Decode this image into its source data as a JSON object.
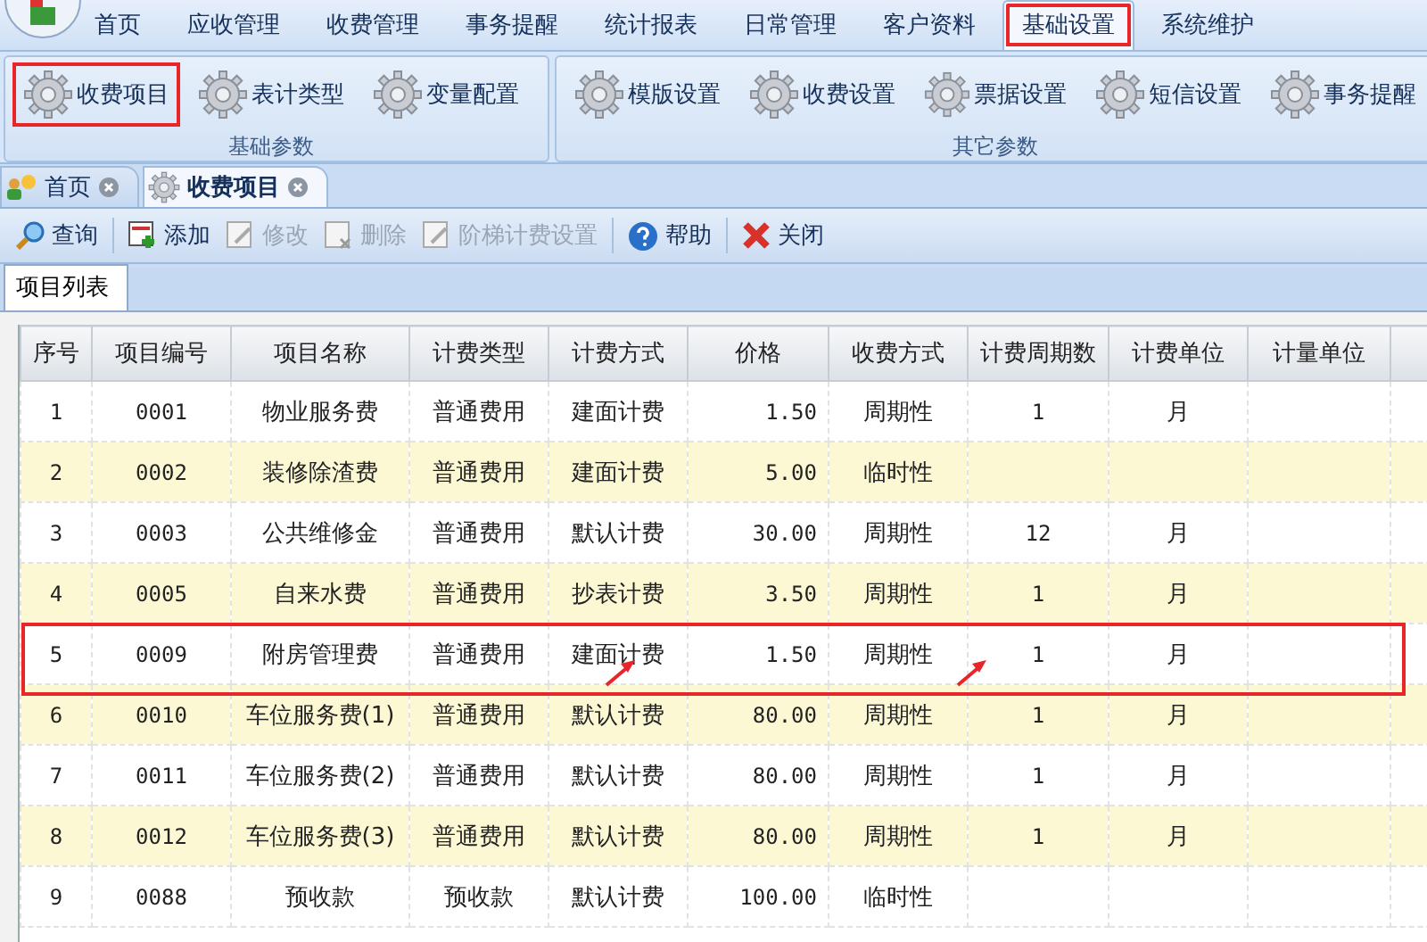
{
  "menu": {
    "items": [
      {
        "label": "首页",
        "selected": false,
        "highlighted": false
      },
      {
        "label": "应收管理",
        "selected": false,
        "highlighted": false
      },
      {
        "label": "收费管理",
        "selected": false,
        "highlighted": false
      },
      {
        "label": "事务提醒",
        "selected": false,
        "highlighted": false
      },
      {
        "label": "统计报表",
        "selected": false,
        "highlighted": false
      },
      {
        "label": "日常管理",
        "selected": false,
        "highlighted": false
      },
      {
        "label": "客户资料",
        "selected": false,
        "highlighted": false
      },
      {
        "label": "基础设置",
        "selected": true,
        "highlighted": true
      },
      {
        "label": "系统维护",
        "selected": false,
        "highlighted": false
      }
    ]
  },
  "ribbon": {
    "groups": [
      {
        "label": "基础参数",
        "buttons": [
          {
            "label": "收费项目",
            "highlighted": true
          },
          {
            "label": "表计类型",
            "highlighted": false
          },
          {
            "label": "变量配置",
            "highlighted": false
          }
        ]
      },
      {
        "label": "其它参数",
        "buttons": [
          {
            "label": "模版设置",
            "highlighted": false
          },
          {
            "label": "收费设置",
            "highlighted": false
          },
          {
            "label": "票据设置",
            "highlighted": false
          },
          {
            "label": "短信设置",
            "highlighted": false
          },
          {
            "label": "事务提醒",
            "highlighted": false
          }
        ]
      }
    ]
  },
  "doc_tabs": [
    {
      "label": "首页",
      "kind": "home",
      "selected": false
    },
    {
      "label": "收费项目",
      "kind": "gear",
      "selected": true
    }
  ],
  "toolbar": [
    {
      "label": "查询",
      "kind": "search",
      "disabled": false
    },
    {
      "label": "添加",
      "kind": "add",
      "disabled": false
    },
    {
      "label": "修改",
      "kind": "edit",
      "disabled": true
    },
    {
      "label": "删除",
      "kind": "delete",
      "disabled": true
    },
    {
      "label": "阶梯计费设置",
      "kind": "edit",
      "disabled": true
    },
    {
      "label": "帮助",
      "kind": "help",
      "disabled": false
    },
    {
      "label": "关闭",
      "kind": "close",
      "disabled": false
    }
  ],
  "sub_tabs": [
    {
      "label": "项目列表",
      "selected": true
    }
  ],
  "table": {
    "columns": [
      "序号",
      "项目编号",
      "项目名称",
      "计费类型",
      "计费方式",
      "价格",
      "收费方式",
      "计费周期数",
      "计费单位",
      "计量单位"
    ],
    "rows": [
      {
        "cells": [
          "1",
          "0001",
          "物业服务费",
          "普通费用",
          "建面计费",
          "1.50",
          "周期性",
          "1",
          "月",
          ""
        ],
        "highlighted": false
      },
      {
        "cells": [
          "2",
          "0002",
          "装修除渣费",
          "普通费用",
          "建面计费",
          "5.00",
          "临时性",
          "",
          "",
          ""
        ],
        "highlighted": false
      },
      {
        "cells": [
          "3",
          "0003",
          "公共维修金",
          "普通费用",
          "默认计费",
          "30.00",
          "周期性",
          "12",
          "月",
          ""
        ],
        "highlighted": false
      },
      {
        "cells": [
          "4",
          "0005",
          "自来水费",
          "普通费用",
          "抄表计费",
          "3.50",
          "周期性",
          "1",
          "月",
          ""
        ],
        "highlighted": false
      },
      {
        "cells": [
          "5",
          "0009",
          "附房管理费",
          "普通费用",
          "建面计费",
          "1.50",
          "周期性",
          "1",
          "月",
          ""
        ],
        "highlighted": true,
        "arrows": [
          false,
          false,
          false,
          false,
          true,
          false,
          true,
          false,
          false,
          false
        ]
      },
      {
        "cells": [
          "6",
          "0010",
          "车位服务费(1)",
          "普通费用",
          "默认计费",
          "80.00",
          "周期性",
          "1",
          "月",
          ""
        ],
        "highlighted": false
      },
      {
        "cells": [
          "7",
          "0011",
          "车位服务费(2)",
          "普通费用",
          "默认计费",
          "80.00",
          "周期性",
          "1",
          "月",
          ""
        ],
        "highlighted": false
      },
      {
        "cells": [
          "8",
          "0012",
          "车位服务费(3)",
          "普通费用",
          "默认计费",
          "80.00",
          "周期性",
          "1",
          "月",
          ""
        ],
        "highlighted": false
      },
      {
        "cells": [
          "9",
          "0088",
          "预收款",
          "预收款",
          "默认计费",
          "100.00",
          "临时性",
          "",
          "",
          ""
        ],
        "highlighted": false
      }
    ]
  }
}
